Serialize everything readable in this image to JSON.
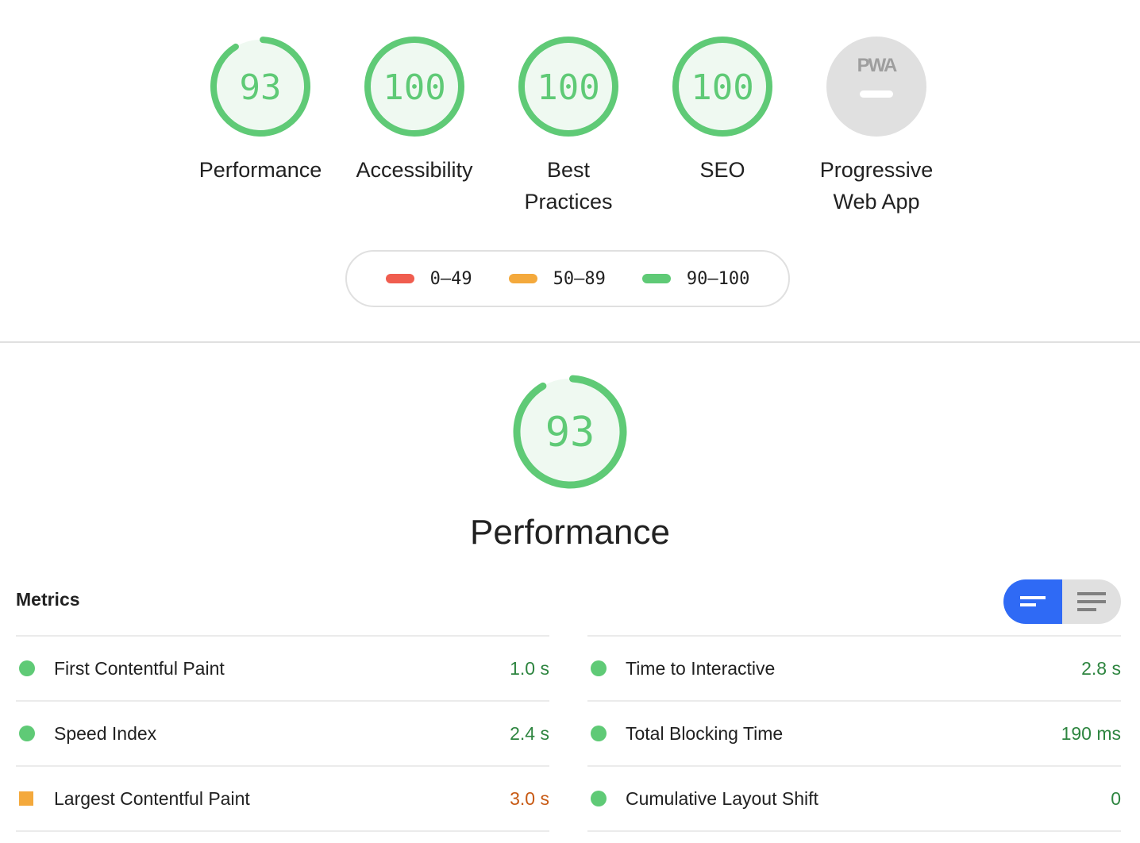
{
  "colors": {
    "pass": "#5fca76",
    "average": "#f4a93c",
    "fail": "#f05d4f",
    "pass_text": "#2e8540",
    "average_text": "#c85a14",
    "pass_fill": "#eff9f1",
    "na_fill": "#e0e0e0",
    "toggle_active": "#2f6af5"
  },
  "gauges": [
    {
      "label": "Performance",
      "score": "93",
      "value": 93
    },
    {
      "label": "Accessibility",
      "score": "100",
      "value": 100
    },
    {
      "label": "Best Practices",
      "score": "100",
      "value": 100
    },
    {
      "label": "SEO",
      "score": "100",
      "value": 100
    },
    {
      "label": "Progressive Web App",
      "badge": "PWA",
      "icon": "pwa-icon"
    }
  ],
  "legend": [
    {
      "range": "0–49",
      "color": "#f05d4f"
    },
    {
      "range": "50–89",
      "color": "#f4a93c"
    },
    {
      "range": "90–100",
      "color": "#5fca76"
    }
  ],
  "performance": {
    "score": "93",
    "value": 93,
    "title": "Performance"
  },
  "metrics": {
    "title": "Metrics",
    "toggle": {
      "compact_icon": "short-lines-icon",
      "expanded_icon": "long-lines-icon"
    },
    "left": [
      {
        "name": "First Contentful Paint",
        "value": "1.0 s",
        "status": "pass"
      },
      {
        "name": "Speed Index",
        "value": "2.4 s",
        "status": "pass"
      },
      {
        "name": "Largest Contentful Paint",
        "value": "3.0 s",
        "status": "average"
      }
    ],
    "right": [
      {
        "name": "Time to Interactive",
        "value": "2.8 s",
        "status": "pass"
      },
      {
        "name": "Total Blocking Time",
        "value": "190 ms",
        "status": "pass"
      },
      {
        "name": "Cumulative Layout Shift",
        "value": "0",
        "status": "pass"
      }
    ]
  }
}
